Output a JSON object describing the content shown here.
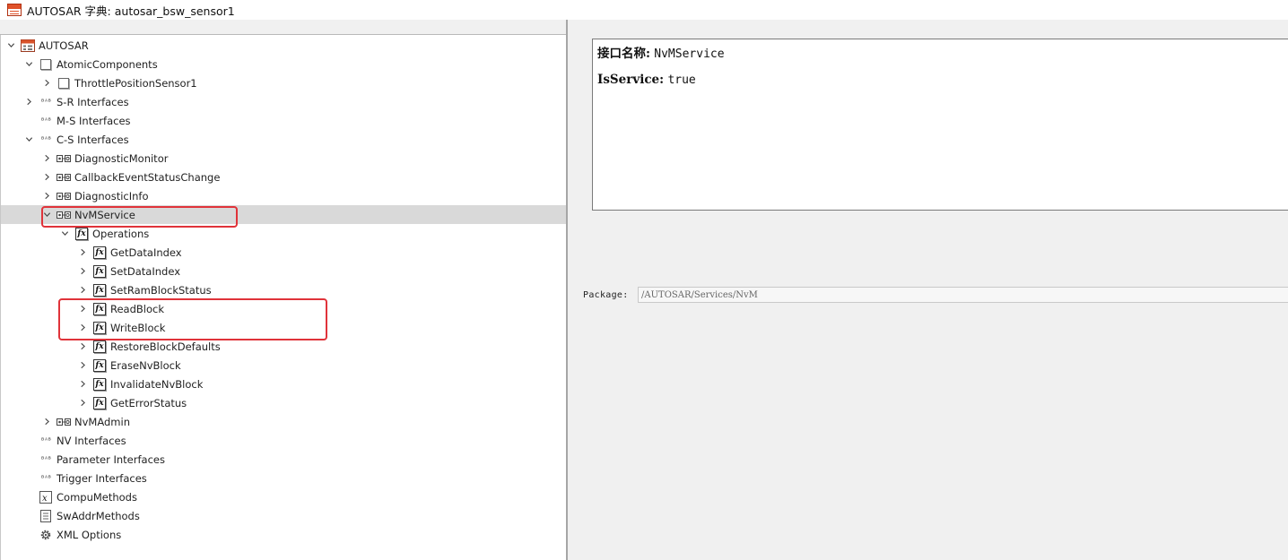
{
  "window": {
    "title": "AUTOSAR 字典: autosar_bsw_sensor1"
  },
  "tree": {
    "items": [
      {
        "label": "AUTOSAR",
        "icon": "autosar-root-icon",
        "expanded": true
      },
      {
        "label": "AtomicComponents",
        "icon": "component-folder-icon",
        "expanded": true
      },
      {
        "label": "ThrottlePositionSensor1",
        "icon": "component-icon",
        "expanded": false
      },
      {
        "label": "S-R Interfaces",
        "icon": "interface-folder-icon",
        "expanded": false
      },
      {
        "label": "M-S Interfaces",
        "icon": "interface-folder-icon",
        "expanded": null
      },
      {
        "label": "C-S Interfaces",
        "icon": "interface-folder-icon",
        "expanded": true
      },
      {
        "label": "DiagnosticMonitor",
        "icon": "cs-interface-icon",
        "expanded": false
      },
      {
        "label": "CallbackEventStatusChange",
        "icon": "cs-interface-icon",
        "expanded": false
      },
      {
        "label": "DiagnosticInfo",
        "icon": "cs-interface-icon",
        "expanded": false
      },
      {
        "label": "NvMService",
        "icon": "cs-interface-icon",
        "expanded": true,
        "selected": true
      },
      {
        "label": "Operations",
        "icon": "function-icon",
        "expanded": true
      },
      {
        "label": "GetDataIndex",
        "icon": "function-icon",
        "expanded": false
      },
      {
        "label": "SetDataIndex",
        "icon": "function-icon",
        "expanded": false
      },
      {
        "label": "SetRamBlockStatus",
        "icon": "function-icon",
        "expanded": false
      },
      {
        "label": "ReadBlock",
        "icon": "function-icon",
        "expanded": false
      },
      {
        "label": "WriteBlock",
        "icon": "function-icon",
        "expanded": false
      },
      {
        "label": "RestoreBlockDefaults",
        "icon": "function-icon",
        "expanded": false
      },
      {
        "label": "EraseNvBlock",
        "icon": "function-icon",
        "expanded": false
      },
      {
        "label": "InvalidateNvBlock",
        "icon": "function-icon",
        "expanded": false
      },
      {
        "label": "GetErrorStatus",
        "icon": "function-icon",
        "expanded": false
      },
      {
        "label": "NvMAdmin",
        "icon": "cs-interface-icon",
        "expanded": false
      },
      {
        "label": "NV Interfaces",
        "icon": "interface-folder-icon",
        "expanded": null
      },
      {
        "label": "Parameter Interfaces",
        "icon": "interface-folder-icon",
        "expanded": null
      },
      {
        "label": "Trigger Interfaces",
        "icon": "interface-folder-icon",
        "expanded": null
      },
      {
        "label": "CompuMethods",
        "icon": "compu-method-icon",
        "expanded": null
      },
      {
        "label": "SwAddrMethods",
        "icon": "document-icon",
        "expanded": null
      },
      {
        "label": "XML Options",
        "icon": "gear-icon",
        "expanded": null
      }
    ]
  },
  "details": {
    "name_key": "接口名称:",
    "name_value": "NvMService",
    "service_key": "IsService:",
    "service_value": "true",
    "package_label": "Package:",
    "package_value": "/AUTOSAR/Services/NvM"
  },
  "colors": {
    "highlight": "#e0333a",
    "selection": "#d9d9d9",
    "pane_bg": "#f0f0f0"
  }
}
